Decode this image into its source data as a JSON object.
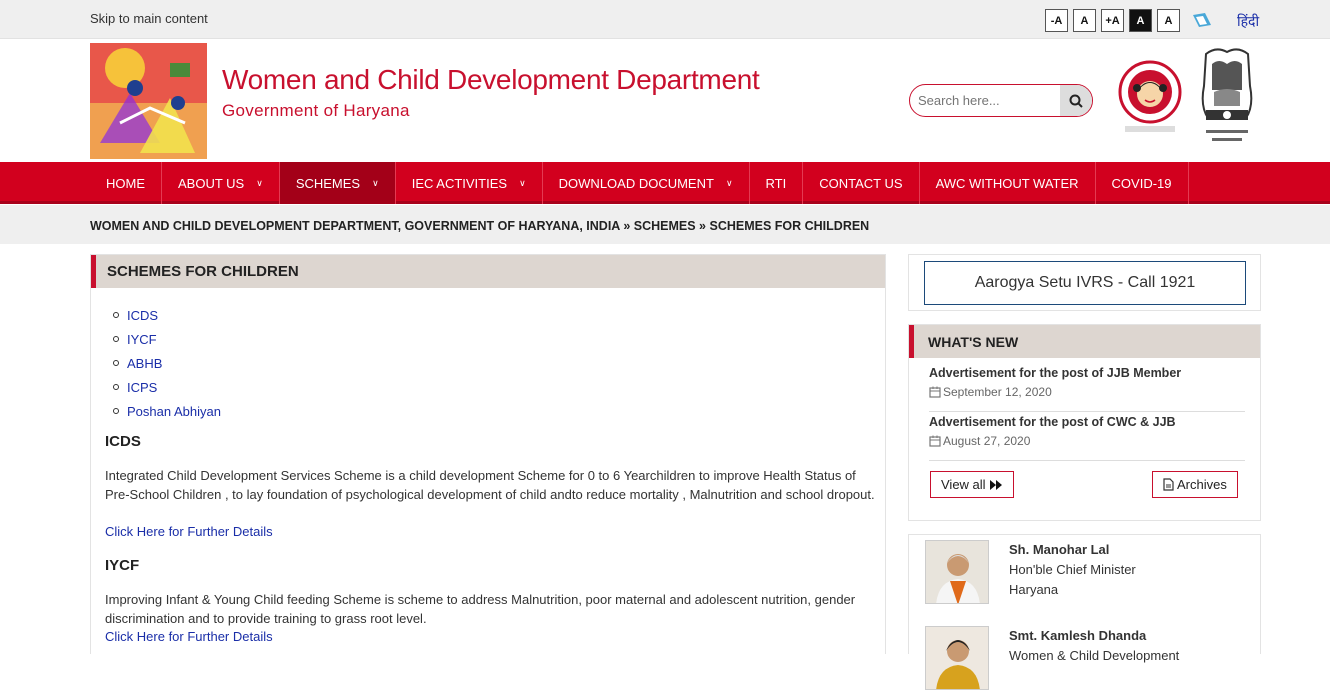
{
  "topbar": {
    "skip": "Skip to main content",
    "font_buttons": [
      "-A",
      "A",
      "+A",
      "A",
      "A"
    ],
    "hindi": "हिंदी"
  },
  "header": {
    "title": "Women and Child Development Department",
    "subtitle": "Government of Haryana",
    "search_placeholder": "Search here..."
  },
  "nav": {
    "items": [
      {
        "label": "HOME",
        "dropdown": false
      },
      {
        "label": "ABOUT US",
        "dropdown": true
      },
      {
        "label": "SCHEMES",
        "dropdown": true,
        "active": true
      },
      {
        "label": "IEC ACTIVITIES",
        "dropdown": true
      },
      {
        "label": "DOWNLOAD DOCUMENT",
        "dropdown": true
      },
      {
        "label": "RTI",
        "dropdown": false
      },
      {
        "label": "CONTACT US",
        "dropdown": false
      },
      {
        "label": "AWC WITHOUT WATER",
        "dropdown": false
      },
      {
        "label": "COVID-19",
        "dropdown": false
      }
    ]
  },
  "breadcrumb": "WOMEN AND CHILD DEVELOPMENT DEPARTMENT, GOVERNMENT OF HARYANA, INDIA » SCHEMES » SCHEMES FOR CHILDREN",
  "main": {
    "heading": "SCHEMES FOR CHILDREN",
    "links": [
      "ICDS",
      "IYCF",
      "ABHB",
      "ICPS",
      "Poshan Abhiyan"
    ],
    "sections": [
      {
        "title": "ICDS",
        "text": "Integrated Child Development Services Scheme is a child development Scheme for 0 to 6 Yearchildren to improve Health Status of Pre-School Children , to lay foundation of psychological development of child andto reduce mortality , Malnutrition and school dropout.",
        "link": "Click Here for Further Details"
      },
      {
        "title": "IYCF",
        "text": "Improving Infant & Young Child feeding Scheme is scheme to address Malnutrition, poor maternal and adolescent nutrition, gender discrimination and to provide training to grass root level.",
        "link": "Click Here for Further Details"
      }
    ]
  },
  "sidebar": {
    "aarogya": "Aarogya Setu IVRS - Call 1921",
    "whats_new": {
      "heading": "WHAT'S NEW",
      "items": [
        {
          "title": "Advertisement for the post of JJB Member",
          "date": "September 12, 2020"
        },
        {
          "title": "Advertisement for the post of CWC & JJB",
          "date": "August 27, 2020"
        }
      ],
      "view_all": "View all",
      "archives": "Archives"
    },
    "people": [
      {
        "name": "Sh. Manohar Lal",
        "role": "Hon'ble Chief Minister",
        "place": "Haryana"
      },
      {
        "name": "Smt. Kamlesh Dhanda",
        "role": "Women & Child Development"
      }
    ]
  },
  "colors": {
    "brand_red": "#d2001e",
    "link_blue": "#1a2ea8",
    "panel_beige": "#ddd6d0"
  }
}
